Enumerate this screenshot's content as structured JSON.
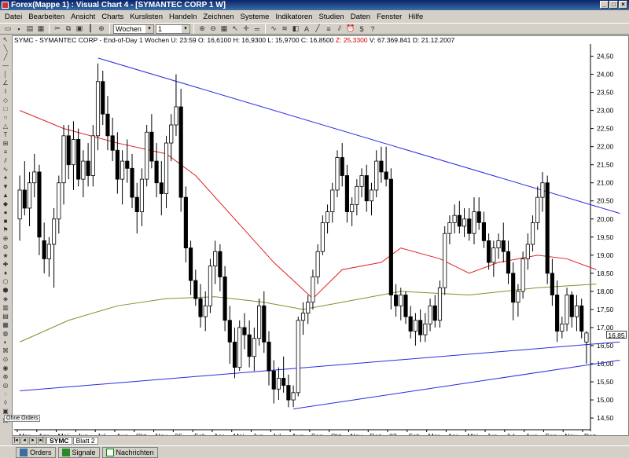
{
  "window": {
    "title": "Forex(Mappe 1) : Visual Chart 4 - [SYMANTEC CORP 1 W]"
  },
  "menu": [
    "Datei",
    "Bearbeiten",
    "Ansicht",
    "Charts",
    "Kurslisten",
    "Handeln",
    "Zeichnen",
    "Systeme",
    "Indikatoren",
    "Studien",
    "Daten",
    "Fenster",
    "Hilfe"
  ],
  "toolbar": {
    "period": "Wochen",
    "multiplier": "1"
  },
  "chart": {
    "symbol": "SYMC - SYMANTEC CORP - End-of-Day 1 Wochen",
    "info": "U: 23:59  O: 16,6100  H: 16,9300  L: 15,9700  C: 16,8500",
    "z_label": "Z: 25,3300",
    "volume_date": "V: 67.369.841  D: 21.12.2007",
    "last_price": "16,85",
    "orders_tag": "Ohne Orders"
  },
  "chart_data": {
    "type": "candlestick",
    "y_ticks": [
      "24,50",
      "24,00",
      "23,50",
      "23,00",
      "22,50",
      "22,00",
      "21,50",
      "21,00",
      "20,50",
      "20,00",
      "19,50",
      "19,00",
      "18,50",
      "18,00",
      "17,50",
      "17,00",
      "16,50",
      "16,00",
      "15,50",
      "15,00",
      "14,50"
    ],
    "ylim": [
      14.35,
      24.75
    ],
    "x_labels": [
      "Mar",
      "Apr",
      "Mai",
      "Jun",
      "Jul",
      "Aug",
      "Okt",
      "Nov",
      "06",
      "Feb",
      "Apr",
      "Mai",
      "Jun",
      "Jul",
      "Aug",
      "Sep",
      "Okt",
      "Nov",
      "Dez",
      "07",
      "Feb",
      "Mar",
      "Apr",
      "Mai",
      "Jun",
      "Jul",
      "Aug",
      "Sep",
      "Nov",
      "Dez"
    ],
    "candles": [
      [
        20.0,
        21.2,
        19.4,
        20.8
      ],
      [
        20.8,
        21.6,
        20.1,
        20.3
      ],
      [
        20.3,
        21.3,
        19.8,
        21.0
      ],
      [
        21.0,
        21.8,
        20.6,
        21.3
      ],
      [
        21.3,
        21.5,
        19.0,
        19.5
      ],
      [
        19.4,
        19.9,
        18.5,
        18.9
      ],
      [
        18.9,
        19.5,
        18.4,
        19.3
      ],
      [
        19.3,
        20.3,
        18.1,
        20.0
      ],
      [
        20.0,
        21.2,
        19.6,
        21.0
      ],
      [
        21.0,
        22.6,
        20.4,
        22.3
      ],
      [
        22.3,
        22.6,
        21.1,
        21.5
      ],
      [
        21.5,
        22.7,
        20.8,
        22.2
      ],
      [
        22.2,
        22.5,
        20.9,
        21.1
      ],
      [
        21.1,
        21.9,
        20.6,
        21.6
      ],
      [
        21.6,
        22.1,
        20.9,
        21.2
      ],
      [
        21.2,
        22.6,
        20.9,
        22.3
      ],
      [
        22.3,
        24.3,
        21.9,
        23.8
      ],
      [
        23.8,
        24.1,
        22.6,
        22.9
      ],
      [
        22.9,
        23.4,
        21.9,
        22.3
      ],
      [
        22.3,
        22.8,
        21.6,
        21.9
      ],
      [
        21.9,
        22.4,
        20.7,
        21.1
      ],
      [
        21.1,
        21.9,
        20.4,
        21.6
      ],
      [
        21.6,
        22.2,
        21.0,
        21.4
      ],
      [
        21.4,
        21.8,
        20.3,
        20.6
      ],
      [
        20.6,
        21.0,
        19.6,
        20.2
      ],
      [
        20.2,
        21.4,
        19.8,
        21.1
      ],
      [
        21.1,
        22.6,
        20.9,
        22.4
      ],
      [
        22.4,
        22.9,
        21.4,
        21.6
      ],
      [
        21.6,
        22.1,
        20.6,
        21.0
      ],
      [
        21.0,
        21.6,
        20.1,
        20.7
      ],
      [
        20.7,
        22.3,
        20.3,
        22.1
      ],
      [
        22.1,
        22.9,
        21.6,
        22.6
      ],
      [
        22.6,
        24.0,
        22.3,
        23.1
      ],
      [
        23.1,
        23.6,
        20.2,
        20.6
      ],
      [
        20.6,
        20.9,
        18.8,
        19.2
      ],
      [
        19.2,
        19.4,
        17.9,
        18.3
      ],
      [
        18.3,
        18.6,
        17.6,
        17.8
      ],
      [
        17.8,
        18.2,
        17.0,
        17.3
      ],
      [
        17.3,
        18.0,
        16.9,
        17.6
      ],
      [
        17.6,
        18.9,
        17.4,
        18.7
      ],
      [
        18.7,
        19.4,
        18.2,
        19.1
      ],
      [
        19.1,
        19.3,
        18.0,
        18.4
      ],
      [
        18.4,
        18.7,
        16.9,
        17.2
      ],
      [
        17.2,
        17.6,
        16.0,
        16.6
      ],
      [
        16.6,
        17.0,
        15.6,
        15.9
      ],
      [
        15.9,
        17.2,
        15.8,
        17.0
      ],
      [
        17.0,
        17.4,
        16.4,
        16.8
      ],
      [
        16.8,
        17.2,
        15.9,
        16.2
      ],
      [
        16.2,
        17.0,
        15.8,
        16.7
      ],
      [
        16.7,
        17.8,
        16.5,
        17.6
      ],
      [
        17.6,
        18.0,
        16.3,
        16.6
      ],
      [
        16.6,
        16.9,
        15.4,
        15.8
      ],
      [
        15.8,
        16.1,
        14.9,
        15.3
      ],
      [
        15.3,
        15.9,
        15.0,
        15.6
      ],
      [
        15.6,
        16.2,
        15.2,
        15.4
      ],
      [
        15.4,
        15.7,
        14.8,
        15.0
      ],
      [
        15.0,
        15.4,
        14.8,
        15.2
      ],
      [
        15.2,
        17.3,
        15.1,
        17.2
      ],
      [
        17.2,
        17.7,
        16.8,
        17.4
      ],
      [
        17.4,
        17.9,
        17.1,
        17.7
      ],
      [
        17.7,
        18.6,
        17.5,
        18.4
      ],
      [
        18.4,
        19.3,
        18.2,
        19.1
      ],
      [
        19.1,
        20.1,
        19.0,
        19.9
      ],
      [
        19.9,
        20.4,
        19.6,
        20.2
      ],
      [
        20.2,
        21.0,
        19.9,
        20.8
      ],
      [
        20.8,
        21.9,
        20.6,
        21.7
      ],
      [
        21.7,
        22.1,
        20.9,
        21.2
      ],
      [
        21.2,
        21.5,
        19.9,
        20.2
      ],
      [
        20.2,
        20.6,
        19.8,
        20.4
      ],
      [
        20.4,
        21.1,
        20.1,
        20.9
      ],
      [
        20.9,
        21.4,
        20.6,
        21.2
      ],
      [
        21.2,
        21.5,
        20.2,
        20.5
      ],
      [
        20.5,
        21.0,
        20.1,
        20.8
      ],
      [
        20.8,
        21.9,
        20.6,
        21.6
      ],
      [
        21.6,
        22.0,
        21.0,
        21.3
      ],
      [
        21.3,
        22.0,
        20.9,
        21.1
      ],
      [
        21.1,
        21.4,
        17.5,
        17.9
      ],
      [
        17.9,
        18.2,
        17.3,
        17.6
      ],
      [
        17.6,
        18.1,
        17.2,
        17.9
      ],
      [
        17.9,
        18.0,
        17.1,
        17.3
      ],
      [
        17.3,
        17.6,
        16.7,
        16.9
      ],
      [
        16.9,
        17.4,
        16.5,
        17.2
      ],
      [
        17.2,
        17.5,
        16.6,
        16.8
      ],
      [
        16.8,
        17.4,
        16.6,
        17.1
      ],
      [
        17.1,
        17.8,
        16.9,
        17.6
      ],
      [
        17.6,
        17.9,
        17.0,
        17.2
      ],
      [
        17.2,
        18.3,
        17.0,
        18.1
      ],
      [
        18.1,
        19.8,
        17.9,
        19.6
      ],
      [
        19.6,
        20.1,
        19.3,
        19.9
      ],
      [
        19.9,
        20.4,
        19.6,
        20.1
      ],
      [
        20.1,
        20.5,
        19.6,
        19.8
      ],
      [
        19.8,
        20.3,
        19.5,
        20.0
      ],
      [
        20.0,
        20.3,
        19.4,
        19.6
      ],
      [
        19.6,
        20.6,
        19.3,
        20.2
      ],
      [
        20.2,
        20.6,
        19.7,
        19.9
      ],
      [
        19.9,
        20.2,
        19.2,
        19.4
      ],
      [
        19.4,
        19.6,
        18.6,
        18.8
      ],
      [
        18.8,
        19.4,
        18.4,
        19.2
      ],
      [
        19.2,
        19.6,
        18.9,
        19.4
      ],
      [
        19.4,
        19.9,
        18.8,
        19.1
      ],
      [
        19.1,
        19.4,
        18.2,
        18.5
      ],
      [
        18.5,
        18.8,
        17.2,
        17.7
      ],
      [
        17.7,
        18.2,
        17.3,
        18.0
      ],
      [
        18.0,
        19.1,
        17.8,
        18.9
      ],
      [
        18.9,
        19.6,
        18.6,
        19.3
      ],
      [
        19.3,
        20.1,
        19.1,
        19.9
      ],
      [
        19.9,
        20.9,
        19.7,
        20.6
      ],
      [
        20.6,
        21.3,
        20.2,
        21.0
      ],
      [
        21.0,
        21.2,
        18.2,
        18.5
      ],
      [
        18.5,
        18.9,
        17.6,
        17.9
      ],
      [
        17.9,
        18.3,
        16.6,
        16.9
      ],
      [
        16.9,
        17.3,
        16.7,
        17.1
      ],
      [
        17.1,
        18.1,
        16.9,
        17.9
      ],
      [
        17.9,
        18.0,
        17.0,
        17.3
      ],
      [
        17.3,
        17.9,
        16.9,
        17.6
      ],
      [
        17.6,
        17.8,
        16.7,
        16.9
      ],
      [
        16.6,
        16.9,
        16.0,
        16.85
      ]
    ],
    "sma_short": [
      [
        0,
        23.0
      ],
      [
        9,
        22.5
      ],
      [
        20,
        22.1
      ],
      [
        30,
        21.8
      ],
      [
        36,
        21.2
      ],
      [
        44,
        20.0
      ],
      [
        52,
        18.8
      ],
      [
        60,
        17.8
      ],
      [
        66,
        18.6
      ],
      [
        74,
        18.8
      ],
      [
        78,
        19.2
      ],
      [
        86,
        18.9
      ],
      [
        92,
        18.5
      ],
      [
        98,
        18.8
      ],
      [
        106,
        19.0
      ],
      [
        112,
        18.9
      ],
      [
        118,
        18.6
      ]
    ],
    "sma_long": [
      [
        0,
        16.6
      ],
      [
        10,
        17.2
      ],
      [
        20,
        17.6
      ],
      [
        30,
        17.8
      ],
      [
        40,
        17.85
      ],
      [
        50,
        17.7
      ],
      [
        58,
        17.5
      ],
      [
        66,
        17.7
      ],
      [
        78,
        18.0
      ],
      [
        92,
        17.9
      ],
      [
        106,
        18.1
      ],
      [
        118,
        18.2
      ]
    ],
    "trendlines": [
      [
        [
          16,
          24.45
        ],
        [
          118,
          20.35
        ]
      ],
      [
        [
          0,
          15.25
        ],
        [
          118,
          16.55
        ]
      ],
      [
        [
          56,
          14.75
        ],
        [
          118,
          16.0
        ]
      ]
    ]
  }
}
